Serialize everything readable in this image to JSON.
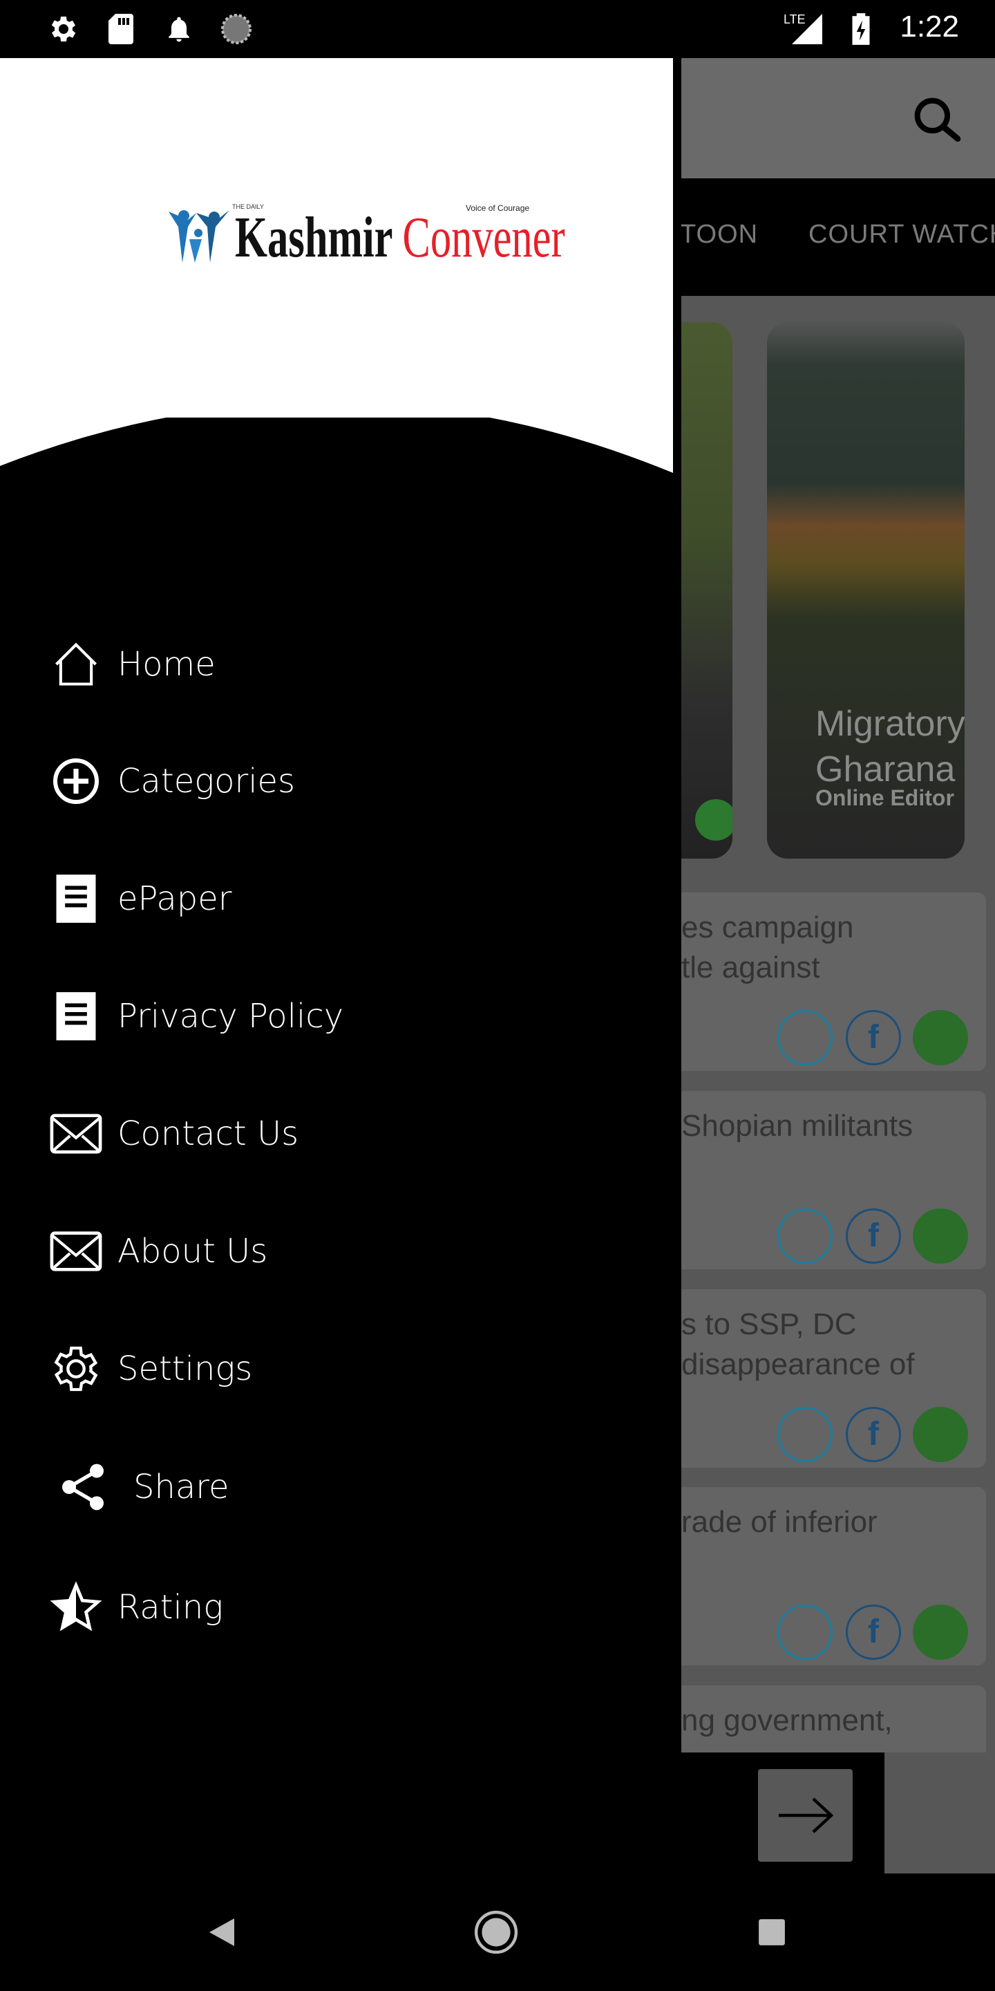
{
  "status_bar": {
    "time": "1:22",
    "network": "LTE",
    "icons": [
      "settings-icon",
      "sd-card-icon",
      "notification-bell-icon",
      "sync-icon",
      "signal-icon",
      "battery-charging-icon"
    ]
  },
  "logo": {
    "small": "THE DAILY",
    "word1": "Kashmir",
    "word2": "Convener",
    "tagline": "Voice of Courage",
    "colors": {
      "word1": "#111111",
      "word2": "#e5202a",
      "figures": "#1f74b8"
    }
  },
  "drawer": {
    "items": [
      {
        "label": "Home",
        "icon": "home-icon"
      },
      {
        "label": "Categories",
        "icon": "add-circle-icon"
      },
      {
        "label": "ePaper",
        "icon": "receipt-icon"
      },
      {
        "label": "Privacy Policy",
        "icon": "receipt-icon"
      },
      {
        "label": "Contact Us",
        "icon": "mail-icon"
      },
      {
        "label": "About Us",
        "icon": "mail-icon"
      },
      {
        "label": "Settings",
        "icon": "gear-icon"
      },
      {
        "label": "Share",
        "icon": "share-icon"
      },
      {
        "label": "Rating",
        "icon": "star-icon"
      }
    ]
  },
  "background": {
    "tabs": [
      "TOON",
      "COURT WATCH"
    ],
    "featured": {
      "title_line1": "Migratory",
      "title_line2": "Gharana",
      "author": "Online Editor"
    },
    "list": [
      {
        "line1": "es campaign",
        "line2": "tle against"
      },
      {
        "line1": "Shopian militants",
        "line2": ""
      },
      {
        "line1": "s to SSP, DC",
        "line2": "disappearance of"
      },
      {
        "line1": "rade of inferior",
        "line2": ""
      },
      {
        "line1": "ng government,",
        "line2": ""
      }
    ],
    "colors": {
      "twitter": "#1a7fa0",
      "facebook": "#1c4f7a",
      "whatsapp": "#2a6e2a"
    }
  }
}
